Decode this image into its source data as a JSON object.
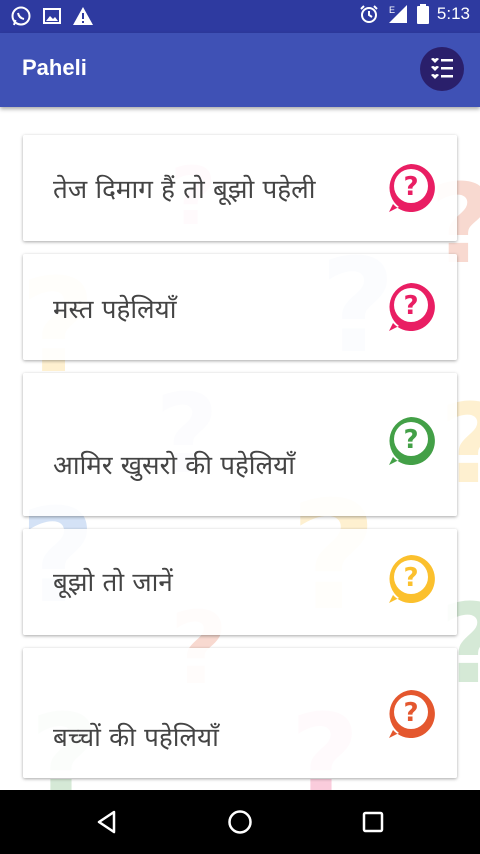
{
  "status_bar": {
    "time": "5:13",
    "left_icons": [
      "whatsapp-icon",
      "image-icon",
      "warning-icon"
    ],
    "right_icons": [
      "alarm-icon",
      "signal-icon",
      "battery-icon"
    ],
    "network_type": "E"
  },
  "app_bar": {
    "title": "Paheli",
    "menu_icon": "list-menu-icon",
    "bar_color": "#3f51b5"
  },
  "categories": [
    {
      "label": "तेज दिमाग हैं तो बूझो पहेली",
      "badge_color": "#e91e63",
      "icon": "question-bubble-icon"
    },
    {
      "label": "मस्त पहेलियाँ",
      "badge_color": "#e91e63",
      "icon": "question-bubble-icon"
    },
    {
      "label": "आमिर खुसरो की पहेलियाँ",
      "badge_color": "#43a047",
      "icon": "question-bubble-icon"
    },
    {
      "label": "बूझो तो जानें",
      "badge_color": "#fbc02d",
      "icon": "question-bubble-icon"
    },
    {
      "label": "बच्चों की पहेलियाँ",
      "badge_color": "#e4572e",
      "icon": "question-bubble-icon"
    }
  ],
  "nav_bar": {
    "icons": [
      "back-icon",
      "home-icon",
      "recents-icon"
    ]
  }
}
